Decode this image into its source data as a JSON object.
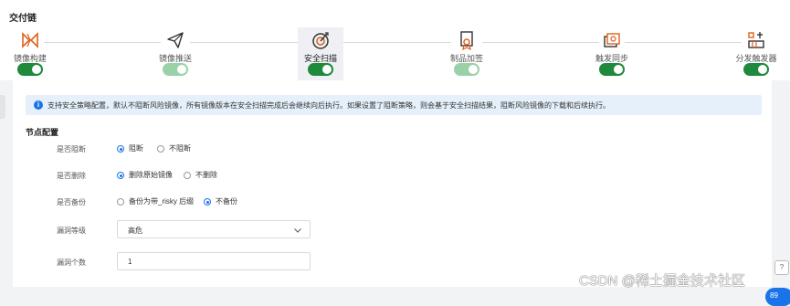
{
  "page": {
    "title": "交付链"
  },
  "steps": [
    {
      "label": "镜像构建",
      "icon": "build-icon",
      "enabled": true,
      "disabled": false,
      "active": false
    },
    {
      "label": "镜像推送",
      "icon": "paper-plane-icon",
      "enabled": true,
      "disabled": true,
      "active": false
    },
    {
      "label": "安全扫描",
      "icon": "target-icon",
      "enabled": true,
      "disabled": false,
      "active": true
    },
    {
      "label": "制品加签",
      "icon": "certificate-icon",
      "enabled": true,
      "disabled": true,
      "active": false
    },
    {
      "label": "触发同步",
      "icon": "sync-icon",
      "enabled": true,
      "disabled": false,
      "active": false
    },
    {
      "label": "分发触发器",
      "icon": "distribution-icon",
      "enabled": true,
      "disabled": false,
      "active": false
    }
  ],
  "info": {
    "text": "支持安全策略配置，默认不阻断风险镜像，所有镜像版本在安全扫描完成后会继续向后执行。如果设置了阻断策略，则会基于安全扫描结果，阻断风险镜像的下载和后续执行。"
  },
  "node_config": {
    "title": "节点配置",
    "block": {
      "label": "是否阻断",
      "options": [
        "阻断",
        "不阻断"
      ],
      "selected": "阻断"
    },
    "delete": {
      "label": "是否删除",
      "options": [
        "删除原始镜像",
        "不删除"
      ],
      "selected": "删除原始镜像"
    },
    "backup": {
      "label": "是否备份",
      "options": [
        "备份为带_risky 后缀",
        "不备份"
      ],
      "selected": "不备份"
    },
    "level": {
      "label": "漏洞等级",
      "value": "高危"
    },
    "count": {
      "label": "漏洞个数",
      "value": "1"
    }
  },
  "watermark": "CSDN @稀土掘金技术社区",
  "colors": {
    "accent": "#1a73e8",
    "toggle_on": "#1f8a3b",
    "toggle_disabled": "#9bd1a9",
    "info_bg": "#e6f0fb"
  }
}
